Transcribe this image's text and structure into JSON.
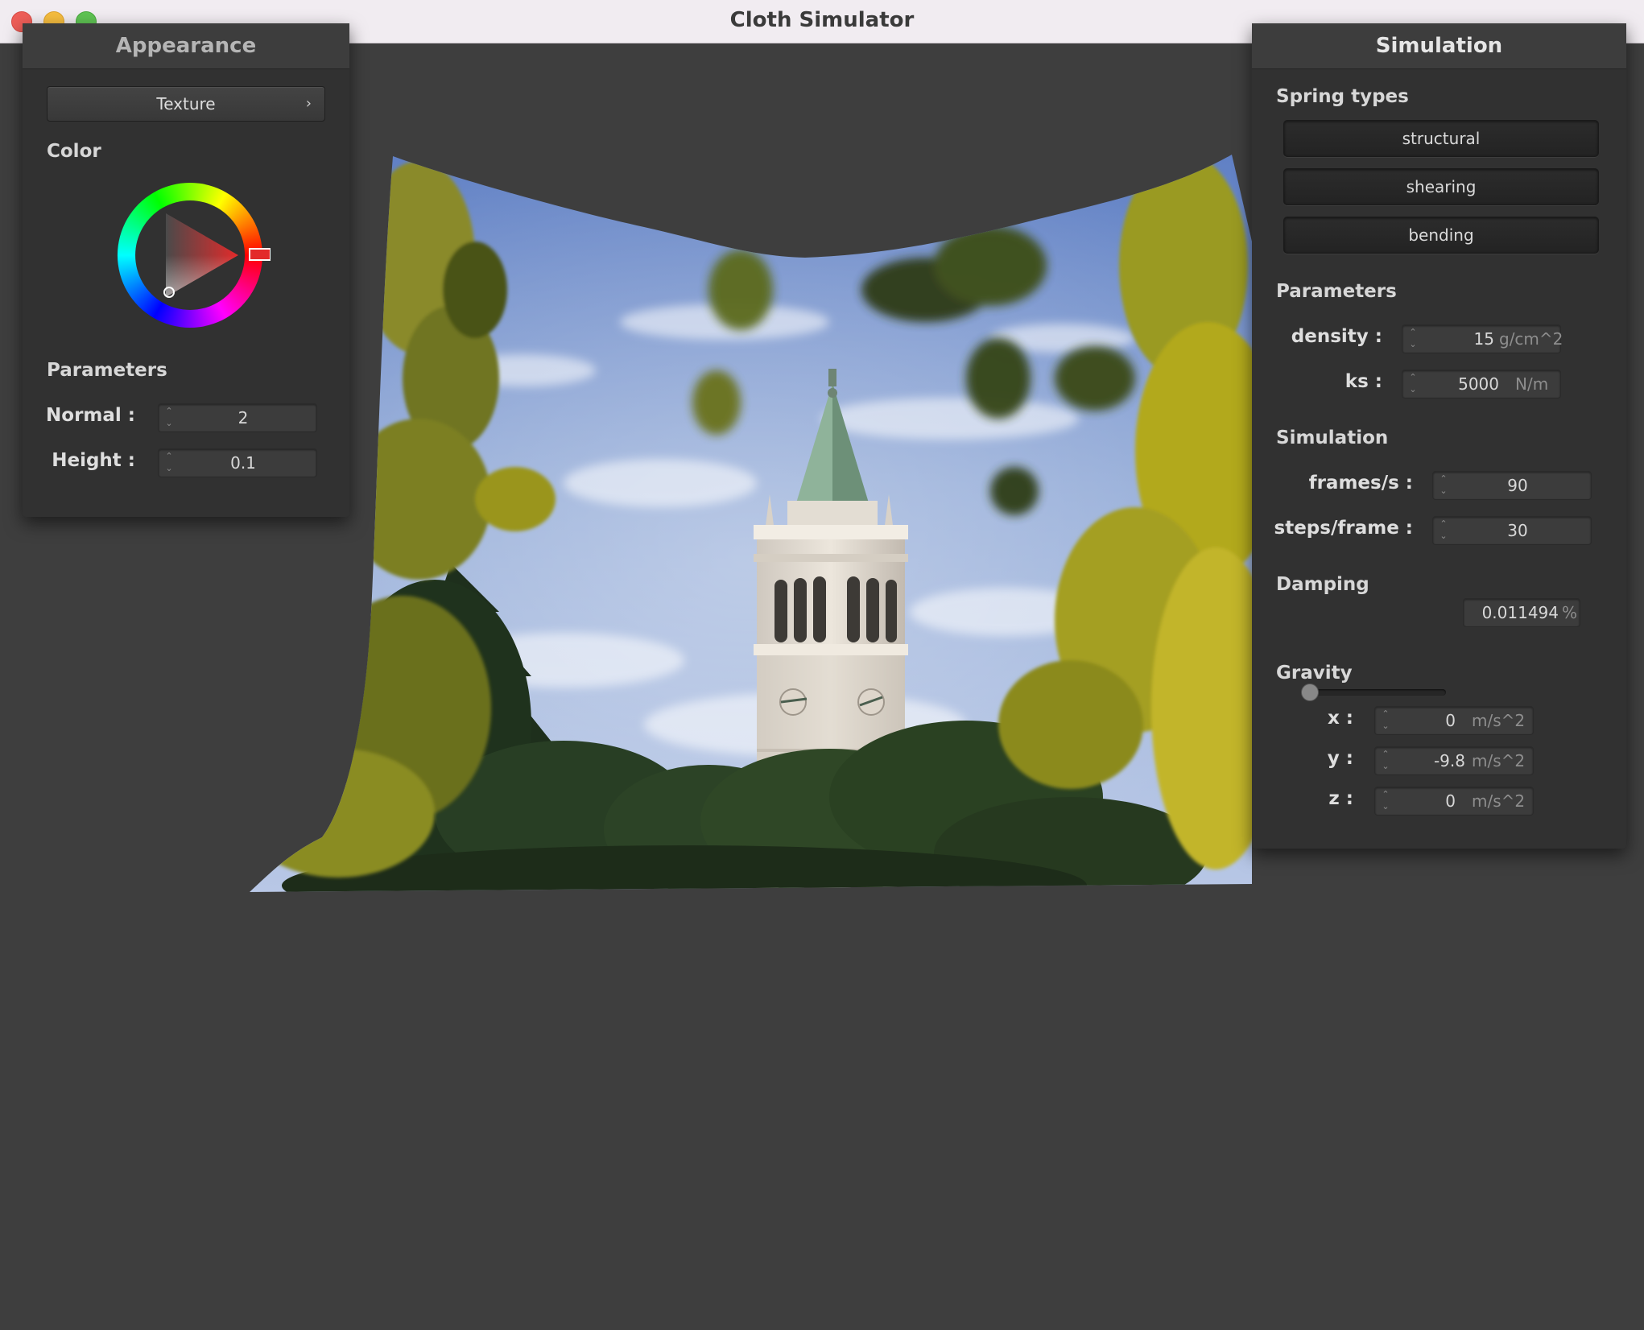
{
  "window": {
    "title": "Cloth Simulator"
  },
  "appearance": {
    "header": "Appearance",
    "texture_button": {
      "label": "Texture",
      "chevron": "chevron-right-icon"
    },
    "color_label": "Color",
    "parameters_label": "Parameters",
    "fields": [
      {
        "label": "Normal :",
        "value": "2"
      },
      {
        "label": "Height :",
        "value": "0.1"
      }
    ],
    "selected_color": "#e32a2a"
  },
  "simulation": {
    "header": "Simulation",
    "spring_types": {
      "label": "Spring types",
      "buttons": [
        "structural",
        "shearing",
        "bending"
      ]
    },
    "parameters": {
      "label": "Parameters",
      "fields": [
        {
          "label": "density :",
          "value": "15",
          "unit": "g/cm^2"
        },
        {
          "label": "ks :",
          "value": "5000",
          "unit": "N/m"
        }
      ]
    },
    "simulation": {
      "label": "Simulation",
      "fields": [
        {
          "label": "frames/s :",
          "value": "90"
        },
        {
          "label": "steps/frame :",
          "value": "30"
        }
      ]
    },
    "damping": {
      "label": "Damping",
      "value": "0.011494",
      "unit": "%",
      "slider_fraction": 0.0
    },
    "gravity": {
      "label": "Gravity",
      "fields": [
        {
          "label": "x :",
          "value": "0",
          "unit": "m/s^2"
        },
        {
          "label": "y :",
          "value": "-9.8",
          "unit": "m/s^2"
        },
        {
          "label": "z :",
          "value": "0",
          "unit": "m/s^2"
        }
      ]
    }
  }
}
